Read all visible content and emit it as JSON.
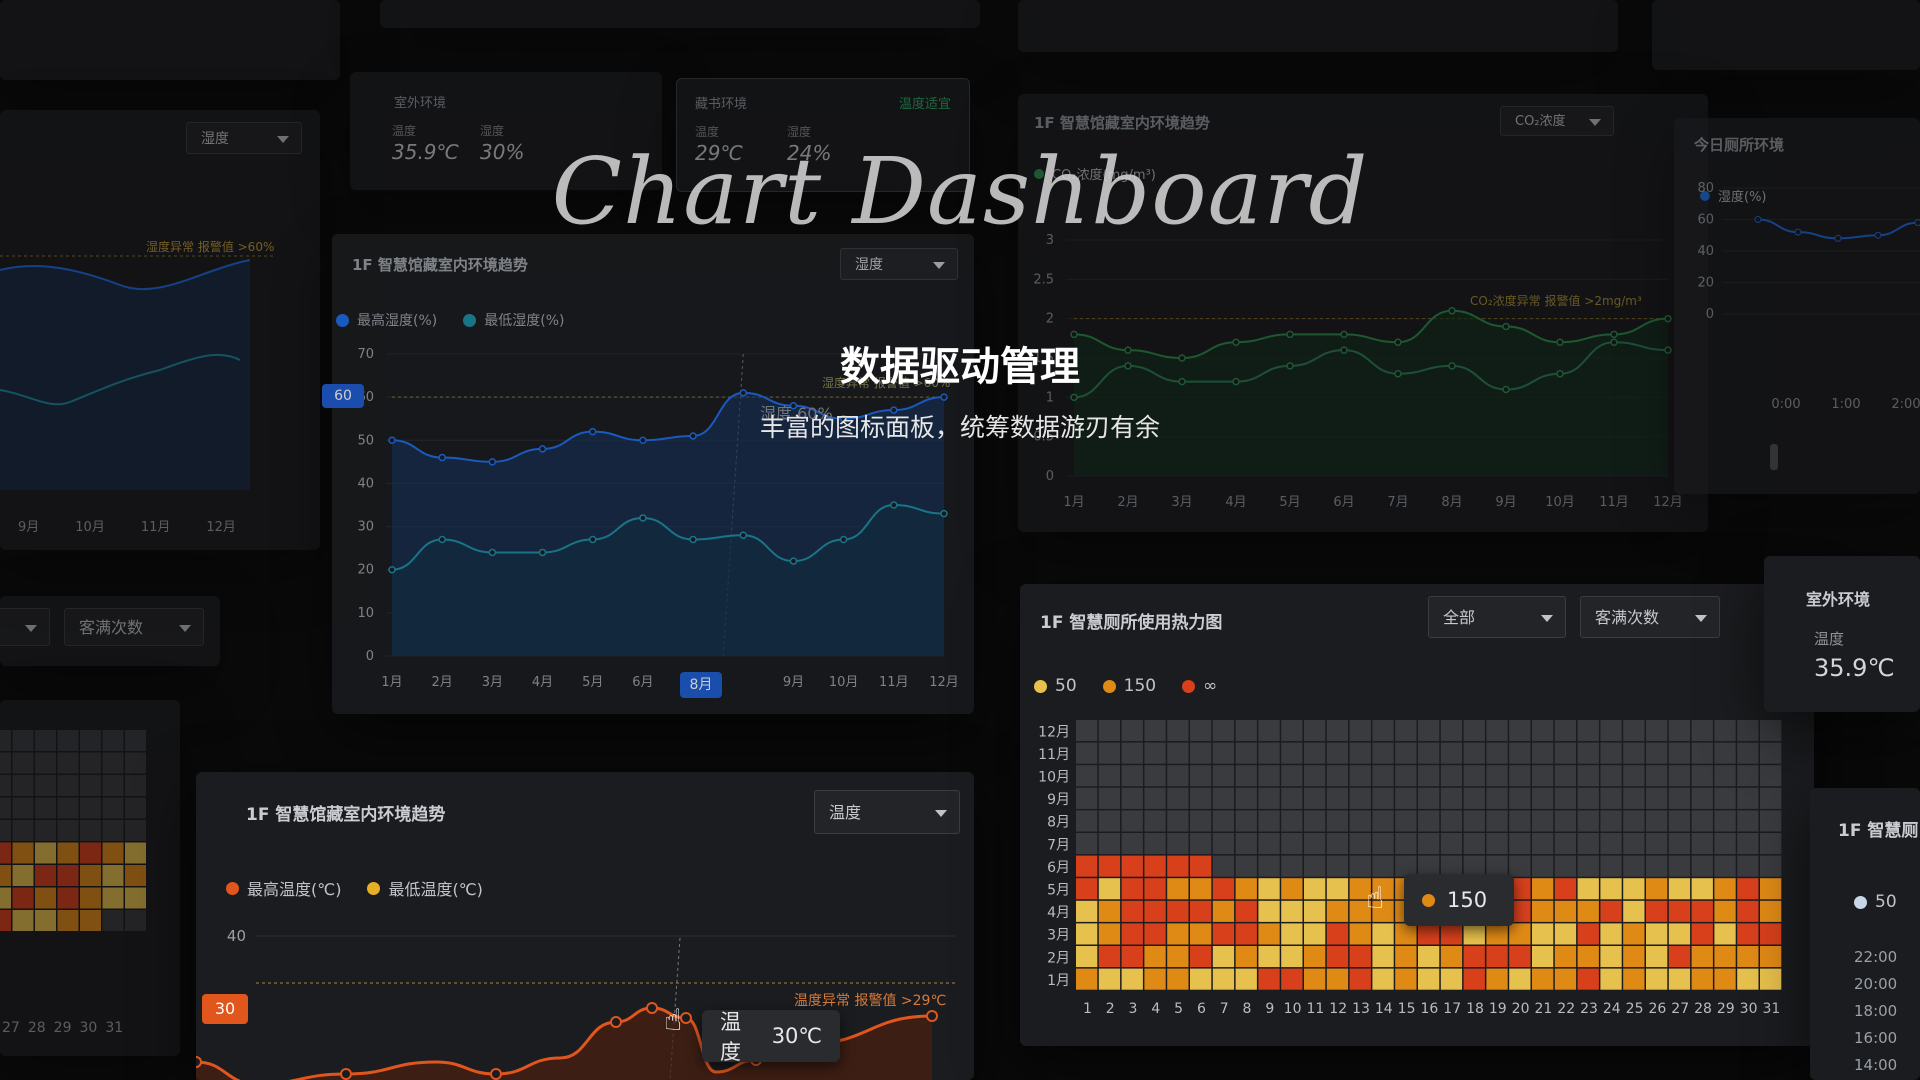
{
  "hero": {
    "title": "Chart Dashboard",
    "heading": "数据驱动管理",
    "subtitle": "丰富的图标面板，统筹数据游刃有余"
  },
  "months": [
    "1月",
    "2月",
    "3月",
    "4月",
    "5月",
    "6月",
    "7月",
    "8月",
    "9月",
    "10月",
    "11月",
    "12月"
  ],
  "top_left_panel": {
    "select": "湿度",
    "alarm": "湿度异常 报警值 >60%",
    "months": [
      "9月",
      "10月",
      "11月",
      "12月"
    ]
  },
  "env_cards": {
    "outdoor": {
      "title": "室外环境",
      "temp_label": "温度",
      "temp": "35.9℃",
      "hum_label": "湿度",
      "hum": "30%"
    },
    "library": {
      "title": "藏书环境",
      "status": "温度适宜",
      "temp_label": "温度",
      "temp": "29℃",
      "hum_label": "湿度",
      "hum": "24%"
    }
  },
  "humidity_panel": {
    "title": "1F 智慧馆藏室内环境趋势",
    "select": "湿度",
    "legend": [
      "最高湿度(%)",
      "最低湿度(%)"
    ],
    "y_ticks": [
      "0",
      "10",
      "20",
      "30",
      "40",
      "50",
      "60",
      "70"
    ],
    "marker": "60",
    "tooltip": "湿度  60%",
    "alarm": "湿度异常 报警值 >60%",
    "highlight_month": "8月"
  },
  "co2_panel": {
    "title": "1F 智慧馆藏室内环境趋势",
    "select": "CO₂浓度",
    "legend": "CO₂浓度(mg/m³)",
    "alarm": "CO₂浓度异常 报警值 >2mg/m³",
    "y_ticks": [
      "0",
      "0.5",
      "1",
      "1.5",
      "2",
      "2.5",
      "3"
    ]
  },
  "today_panel": {
    "title": "今日厕所环境",
    "legend": "湿度(%)",
    "y_ticks": [
      "0",
      "20",
      "40",
      "60",
      "80"
    ],
    "x_ticks": [
      "0:00",
      "1:00",
      "2:00"
    ]
  },
  "left_mid_panel": {
    "select": "客满次数"
  },
  "left_heatmap": {
    "x_ticks": [
      "27",
      "28",
      "29",
      "30",
      "31"
    ]
  },
  "temp_panel": {
    "title": "1F 智慧馆藏室内环境趋势",
    "select": "温度",
    "legend": [
      "最高温度(℃)",
      "最低温度(℃)"
    ],
    "y_ticks": [
      "40"
    ],
    "marker": "30",
    "alarm": "温度异常 报警值 >29℃",
    "tooltip_label": "温度",
    "tooltip_value": "30℃"
  },
  "heatmap_panel": {
    "title": "1F 智慧厕所使用热力图",
    "select_scope": "全部",
    "select_metric": "客满次数",
    "legend": [
      "50",
      "150",
      "∞"
    ],
    "rows": [
      "12月",
      "11月",
      "10月",
      "9月",
      "8月",
      "7月",
      "6月",
      "5月",
      "4月",
      "3月",
      "2月",
      "1月"
    ],
    "cols": [
      "1",
      "2",
      "3",
      "4",
      "5",
      "6",
      "7",
      "8",
      "9",
      "10",
      "11",
      "12",
      "13",
      "14",
      "15",
      "16",
      "17",
      "18",
      "19",
      "20",
      "21",
      "22",
      "23",
      "24",
      "25",
      "26",
      "27",
      "28",
      "29",
      "30",
      "31"
    ],
    "tooltip": "150"
  },
  "right_outdoor": {
    "title": "室外环境",
    "label": "温度",
    "value": "35.9℃"
  },
  "right_bottom_panel": {
    "title": "1F 智慧厕",
    "legend": "50",
    "y_ticks": [
      "22:00",
      "20:00",
      "18:00",
      "16:00",
      "14:00"
    ]
  },
  "colors": {
    "blue": "#1f6feb",
    "teal": "#1f8fa8",
    "green": "#2e9b4f",
    "orange": "#e0561d",
    "yellow": "#e7c14d",
    "amber": "#e08a16",
    "red": "#d8401c"
  },
  "chart_data": [
    {
      "type": "line",
      "title": "1F 智慧馆藏室内环境趋势",
      "categories": [
        "1月",
        "2月",
        "3月",
        "4月",
        "5月",
        "6月",
        "7月",
        "8月",
        "9月",
        "10月",
        "11月",
        "12月"
      ],
      "series": [
        {
          "name": "最高湿度(%)",
          "values": [
            50,
            46,
            45,
            48,
            52,
            50,
            51,
            61,
            58,
            55,
            57,
            60
          ]
        },
        {
          "name": "最低湿度(%)",
          "values": [
            20,
            27,
            24,
            24,
            27,
            32,
            27,
            28,
            22,
            27,
            35,
            33
          ]
        }
      ],
      "ylim": [
        0,
        70
      ]
    },
    {
      "type": "line",
      "title": "1F 智慧馆藏室内环境趋势",
      "categories": [
        "1月",
        "2月",
        "3月",
        "4月",
        "5月",
        "6月",
        "7月",
        "8月",
        "9月",
        "10月",
        "11月",
        "12月"
      ],
      "series": [
        {
          "name": "CO₂浓度(mg/m³)",
          "values": [
            1.8,
            1.6,
            1.5,
            1.7,
            1.8,
            1.8,
            1.7,
            2.1,
            1.9,
            1.7,
            1.8,
            2.0
          ]
        },
        {
          "values": [
            1.0,
            1.4,
            1.2,
            1.2,
            1.4,
            1.6,
            1.3,
            1.4,
            1.1,
            1.3,
            1.7,
            1.6
          ]
        }
      ],
      "ylim": [
        0,
        3
      ]
    },
    {
      "type": "heatmap",
      "title": "1F 智慧厕所使用热力图",
      "rows": [
        "1月",
        "2月",
        "3月",
        "4月",
        "5月",
        "6月"
      ],
      "levels": [
        "50",
        "150",
        "∞"
      ],
      "cells": [
        "21122111332231211321223121122111",
        "13322312112331212333122121322221",
        "12332233211321233122113121131332",
        "12333323111222232123222313332320",
        "31332232121122211113231112112322",
        "33333300000000000000000000000000"
      ]
    }
  ]
}
